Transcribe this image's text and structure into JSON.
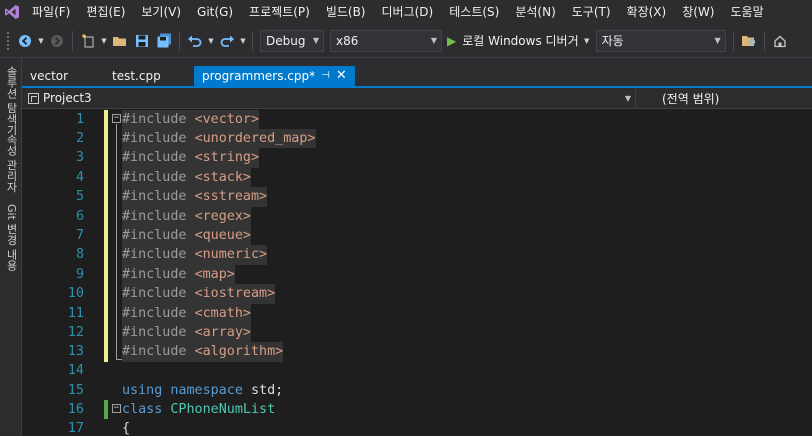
{
  "menu": [
    "파일(F)",
    "편집(E)",
    "보기(V)",
    "Git(G)",
    "프로젝트(P)",
    "빌드(B)",
    "디버그(D)",
    "테스트(S)",
    "분석(N)",
    "도구(T)",
    "확장(X)",
    "창(W)",
    "도움말"
  ],
  "toolbar": {
    "configuration": "Debug",
    "platform": "x86",
    "run_label": "로컬 Windows 디버거",
    "run_mode": "자동"
  },
  "side_tabs": [
    "솔루션 탐색기",
    "속성 관리자",
    "Git 변경 내용"
  ],
  "tabs": [
    "vector",
    "test.cpp",
    "programmers.cpp*"
  ],
  "navbar": {
    "project": "Project3",
    "scope": "(전역 범위)"
  },
  "editor": {
    "lines": [
      {
        "n": "1",
        "pp": "#include",
        "hdr": "<vector>"
      },
      {
        "n": "2",
        "pp": "#include",
        "hdr": "<unordered_map>"
      },
      {
        "n": "3",
        "pp": "#include",
        "hdr": "<string>"
      },
      {
        "n": "4",
        "pp": "#include",
        "hdr": "<stack>"
      },
      {
        "n": "5",
        "pp": "#include",
        "hdr": "<sstream>"
      },
      {
        "n": "6",
        "pp": "#include",
        "hdr": "<regex>"
      },
      {
        "n": "7",
        "pp": "#include",
        "hdr": "<queue>"
      },
      {
        "n": "8",
        "pp": "#include",
        "hdr": "<numeric>"
      },
      {
        "n": "9",
        "pp": "#include",
        "hdr": "<map>"
      },
      {
        "n": "10",
        "pp": "#include",
        "hdr": "<iostream>"
      },
      {
        "n": "11",
        "pp": "#include",
        "hdr": "<cmath>"
      },
      {
        "n": "12",
        "pp": "#include",
        "hdr": "<array>"
      },
      {
        "n": "13",
        "pp": "#include",
        "hdr": "<algorithm>"
      }
    ],
    "line14": "14",
    "line15": {
      "n": "15",
      "kw1": "using",
      "kw2": "namespace",
      "rest": "std;"
    },
    "line16": {
      "n": "16",
      "kw": "class",
      "name": "CPhoneNumList"
    },
    "line17": {
      "n": "17",
      "text": "{"
    }
  }
}
